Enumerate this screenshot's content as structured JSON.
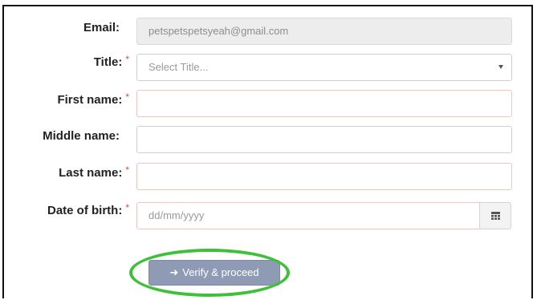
{
  "form": {
    "email": {
      "label": "Email:",
      "value": "petspetspetsyeah@gmail.com"
    },
    "title": {
      "label": "Title:",
      "required_marker": "*",
      "placeholder": "Select Title..."
    },
    "first_name": {
      "label": "First name:",
      "required_marker": "*",
      "value": ""
    },
    "middle_name": {
      "label": "Middle name:",
      "value": ""
    },
    "last_name": {
      "label": "Last name:",
      "required_marker": "*",
      "value": ""
    },
    "date_of_birth": {
      "label": "Date of birth:",
      "required_marker": "*",
      "placeholder": "dd/mm/yyyy",
      "icon": "calendar-icon"
    },
    "submit": {
      "label": "Verify & proceed",
      "icon": "arrow-right-icon"
    }
  },
  "annotation": {
    "highlight_color": "#3ec03a"
  },
  "colors": {
    "button_bg": "#8f9bb5",
    "required_marker": "#e04848",
    "readonly_bg": "#ededed"
  }
}
